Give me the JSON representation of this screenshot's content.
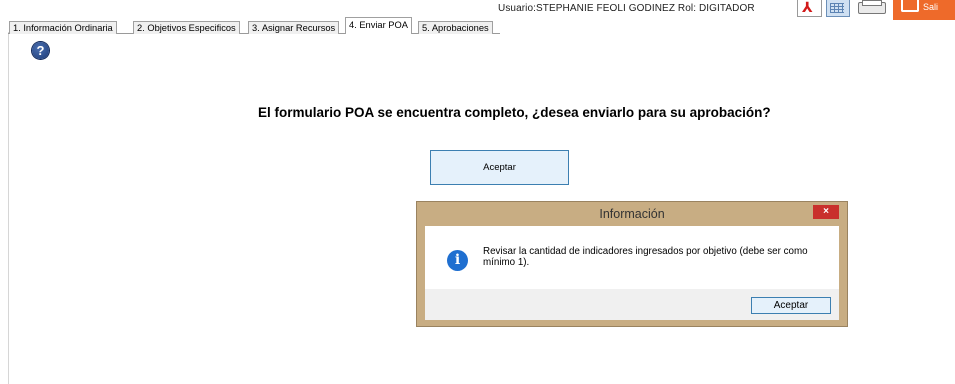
{
  "header": {
    "user_info": "Usuario:STEPHANIE FEOLI GODINEZ  Rol: DIGITADOR"
  },
  "toolbar": {
    "icons": [
      "pdf-icon",
      "excel-icon",
      "print-icon",
      "exit-icon"
    ],
    "exit_label": "Sali"
  },
  "tabs": [
    {
      "label": "1. Información Ordinaria"
    },
    {
      "label": "2. Objetivos Especificos"
    },
    {
      "label": "3. Asignar Recursos"
    },
    {
      "label": "4. Enviar POA",
      "active": true
    },
    {
      "label": "5. Aprobaciones"
    }
  ],
  "main": {
    "prompt": "El formulario POA se encuentra completo, ¿desea enviarlo para su aprobación?",
    "accept_label": "Aceptar"
  },
  "dialog": {
    "title": "Información",
    "close_glyph": "×",
    "message": "Revisar la cantidad de indicadores ingresados por objetivo (debe ser como mínimo 1).",
    "accept_label": "Aceptar"
  },
  "colors": {
    "dialog_frame": "#c8ad83",
    "close_button": "#c9302c",
    "button_fill": "#e5f1fb",
    "button_border": "#3c7fb1",
    "exit_orange": "#ee6a2a"
  }
}
